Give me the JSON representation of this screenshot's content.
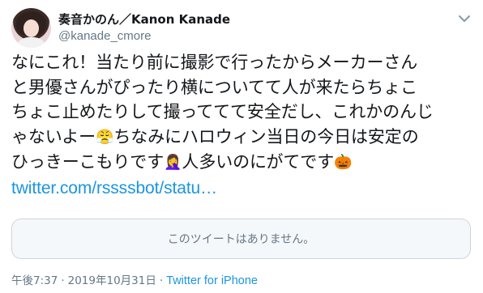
{
  "author": {
    "display_name": "奏音かのん／Kanon Kanade",
    "handle": "@kanade_cmore"
  },
  "tweet": {
    "lines": [
      "なにこれ！当たり前に撮影で行ったからメーカーさん",
      "と男優さんがぴったり横についてて人が来たらちょこ",
      "ちょこ止めたりして撮っててて安全だし、これかのんじ"
    ],
    "line4_before": "ゃないよー",
    "line4_emoji": "😤",
    "line4_after": "ちなみにハロウィン当日の今日は安定の",
    "line5_before": "ひっきーこもりです",
    "line5_emoji": "🤦‍♀️",
    "line5_middle": "人多いのにがてです",
    "line5_emoji2": "🎃",
    "link": "twitter.com/rssssbot/statu…"
  },
  "quoted_tweet": {
    "unavailable_text": "このツイートはありません。"
  },
  "meta": {
    "time": "午後7:37",
    "separator": "·",
    "date": "2019年10月31日",
    "source": "Twitter for iPhone"
  },
  "icons": {
    "menu": "chevron-down-icon",
    "avatar": "avatar"
  },
  "colors": {
    "link": "#1b95e0",
    "secondary": "#657786",
    "text": "#14171a",
    "border": "#ccd6dd"
  }
}
